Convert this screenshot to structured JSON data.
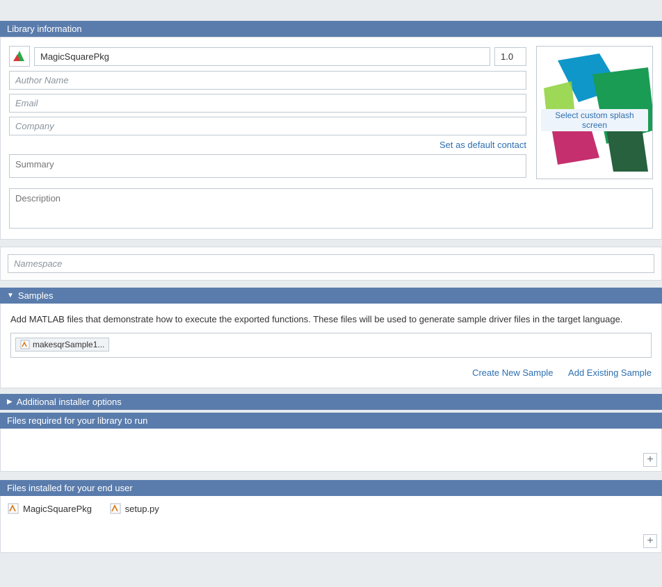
{
  "headers": {
    "library_info": "Library information",
    "samples": "Samples",
    "additional": "Additional installer options",
    "required": "Files required for your library to run",
    "installed": "Files installed for your end user"
  },
  "library": {
    "name": "MagicSquarePkg",
    "version": "1.0",
    "author_placeholder": "Author Name",
    "email_placeholder": "Email",
    "company_placeholder": "Company",
    "set_default_contact": "Set as default contact",
    "summary_placeholder": "Summary",
    "description_placeholder": "Description",
    "splash_label": "Select custom splash screen",
    "namespace_placeholder": "Namespace"
  },
  "samples": {
    "help_text": "Add MATLAB files that demonstrate how to execute the exported functions.  These files will be used to generate sample driver files in the target language.",
    "files": [
      "makesqrSample1..."
    ],
    "create_new": "Create New Sample",
    "add_existing": "Add Existing Sample"
  },
  "installed_files": [
    "MagicSquarePkg",
    "setup.py"
  ]
}
